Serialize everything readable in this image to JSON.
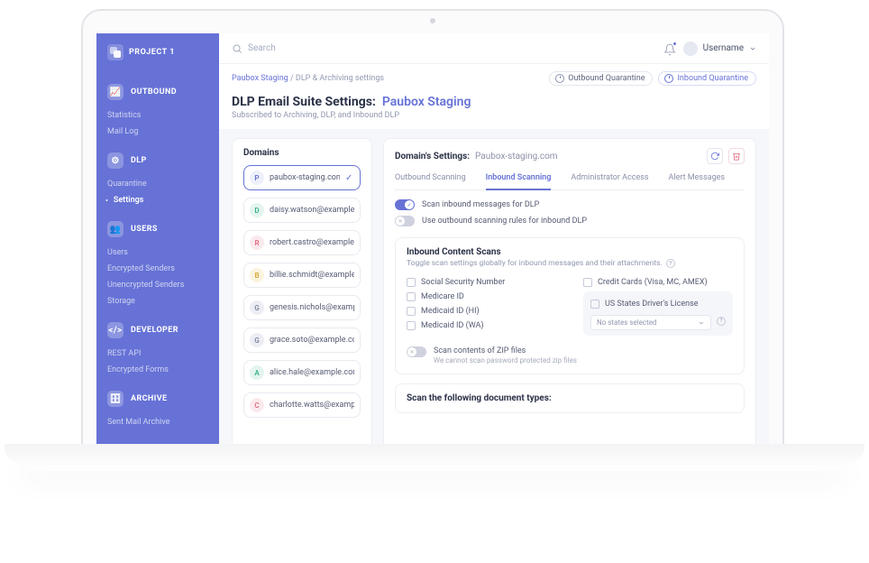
{
  "project_label": "PROJECT 1",
  "sidebar": {
    "sections": [
      {
        "label": "OUTBOUND",
        "icon": "chart",
        "items": [
          "Statistics",
          "Mail Log"
        ]
      },
      {
        "label": "DLP",
        "icon": "sliders",
        "items": [
          "Quarantine",
          "Settings"
        ]
      },
      {
        "label": "USERS",
        "icon": "users",
        "items": [
          "Users",
          "Encrypted Senders",
          "Unencrypted Senders",
          "Storage"
        ]
      },
      {
        "label": "DEVELOPER",
        "icon": "code",
        "items": [
          "REST API",
          "Encrypted Forms"
        ]
      },
      {
        "label": "ARCHIVE",
        "icon": "archive",
        "items": [
          "Sent Mail Archive"
        ]
      }
    ],
    "active_item": "Settings"
  },
  "topbar": {
    "search_placeholder": "Search",
    "username": "Username"
  },
  "breadcrumbs": {
    "parent": "Paubox Staging",
    "sep": " / ",
    "current": "DLP & Archiving settings"
  },
  "quarantine_buttons": {
    "outbound": "Outbound Quarantine",
    "inbound": "Inbound Quarantine"
  },
  "page_title": {
    "prefix": "DLP Email Suite Settings:",
    "name": "Paubox Staging"
  },
  "page_subtitle": "Subscribed to Archiving, DLP, and Inbound DLP",
  "domains_panel": {
    "title": "Domains",
    "items": [
      {
        "letter": "P",
        "label": "paubox-staging.com",
        "color": "#6672d6",
        "bg": "#eef0fb",
        "selected": true
      },
      {
        "letter": "D",
        "label": "daisy.watson@example",
        "color": "#34b28b",
        "bg": "#e4f4ef"
      },
      {
        "letter": "R",
        "label": "robert.castro@example",
        "color": "#e06a7e",
        "bg": "#fbeaed"
      },
      {
        "letter": "B",
        "label": "billie.schmidt@example",
        "color": "#d4a836",
        "bg": "#fbf3de"
      },
      {
        "letter": "G",
        "label": "genesis.nichols@examp",
        "color": "#7f85a0",
        "bg": "#eceef4"
      },
      {
        "letter": "G",
        "label": "grace.soto@example.co",
        "color": "#7f85a0",
        "bg": "#eceef4"
      },
      {
        "letter": "A",
        "label": "alice.hale@example.com",
        "color": "#34b28b",
        "bg": "#e4f4ef"
      },
      {
        "letter": "C",
        "label": "charlotte.watts@examp",
        "color": "#e06a7e",
        "bg": "#fbeaed"
      }
    ]
  },
  "settings_panel": {
    "title": "Domain's Settings:",
    "domain": "Paubox-staging.com",
    "tabs": [
      "Outbound Scanning",
      "Inbound Scanning",
      "Administrator Access",
      "Alert Messages"
    ],
    "active_tab": "Inbound Scanning",
    "toggle_scan_inbound": "Scan inbound messages for DLP",
    "toggle_use_outbound": "Use outbound scanning rules for inbound DLP",
    "content_scans_title": "Inbound Content Scans",
    "content_scans_sub": "Toggle scan settings globally for inbound messages and their attachments.",
    "scan_options_col1": [
      "Social Security Number",
      "Medicare ID",
      "Medicaid ID (HI)",
      "Medicaid ID (WA)"
    ],
    "scan_options_col2_first": "Credit Cards (Visa, MC, AMEX)",
    "drivers_license_label": "US States Driver's License",
    "states_select_placeholder": "No states selected",
    "zip_title": "Scan contents of ZIP files",
    "zip_sub": "We cannot scan password protected zip files",
    "doc_types_title": "Scan the following document types:"
  }
}
